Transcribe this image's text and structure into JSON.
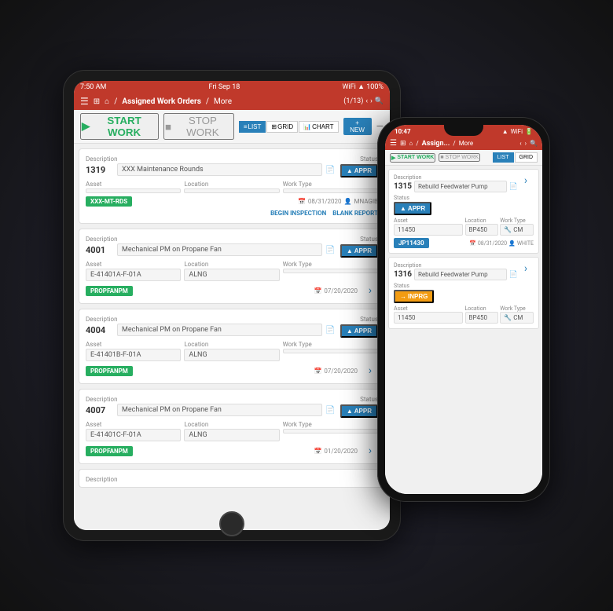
{
  "tablet": {
    "status_bar": {
      "time": "7:50 AM",
      "date": "Fri Sep 18",
      "wifi": "WiFi",
      "battery": "100%"
    },
    "toolbar": {
      "title": "Assigned Work Orders",
      "more": "More",
      "page_count": "(1/13)"
    },
    "action_bar": {
      "start_work": "START WORK",
      "stop_work": "STOP WORK",
      "view_list": "LIST",
      "view_grid": "GRID",
      "view_chart": "CHART",
      "new": "+ NEW"
    },
    "cards": [
      {
        "id": "1319",
        "desc_label": "Description",
        "description": "XXX Maintenance Rounds",
        "status_label": "Status",
        "status": "APPR",
        "asset_label": "Asset",
        "asset": "",
        "location_label": "Location",
        "location": "",
        "worktype_label": "Work Type",
        "worktype": "",
        "tag": "XXX-MT-RDS",
        "tag_color": "green",
        "date": "08/31/2020",
        "user": "MNAGIB",
        "actions": [
          "BEGIN INSPECTION",
          "BLANK REPORT"
        ]
      },
      {
        "id": "4001",
        "desc_label": "Description",
        "description": "Mechanical PM on Propane Fan",
        "status_label": "Status",
        "status": "APPR",
        "asset_label": "Asset",
        "asset": "E-41401A-F-01A",
        "location_label": "Location",
        "location": "ALNG",
        "worktype_label": "Work Type",
        "worktype": "",
        "tag": "PROPFANPM",
        "tag_color": "green",
        "date": "07/20/2020",
        "user": ""
      },
      {
        "id": "4004",
        "desc_label": "Description",
        "description": "Mechanical PM on Propane Fan",
        "status_label": "Status",
        "status": "APPR",
        "asset_label": "Asset",
        "asset": "E-41401B-F-01A",
        "location_label": "Location",
        "location": "ALNG",
        "worktype_label": "Work Type",
        "worktype": "",
        "tag": "PROPFANPM",
        "tag_color": "green",
        "date": "07/20/2020",
        "user": ""
      },
      {
        "id": "4007",
        "desc_label": "Description",
        "description": "Mechanical PM on Propane Fan",
        "status_label": "Status",
        "status": "APPR",
        "asset_label": "Asset",
        "asset": "E-41401C-F-01A",
        "location_label": "Location",
        "location": "ALNG",
        "worktype_label": "Work Type",
        "worktype": "",
        "tag": "PROPFANPM",
        "tag_color": "green",
        "date": "01/20/2020",
        "user": ""
      }
    ]
  },
  "phone": {
    "status_bar": {
      "time": "10:47",
      "signal": "●●●●",
      "wifi": "WiFi",
      "battery": "●"
    },
    "toolbar": {
      "title": "Assign...",
      "more": "More"
    },
    "action_bar": {
      "start_work": "START WORK",
      "stop_work": "STOP WORK",
      "view_list": "LIST",
      "view_grid": "GRID"
    },
    "cards": [
      {
        "id": "1315",
        "desc_label": "Description",
        "description": "Rebuild Feedwater Pump",
        "status_label": "Status",
        "status": "APPR",
        "status_type": "appr",
        "asset_label": "Asset",
        "asset": "11450",
        "location_label": "Location",
        "location": "BP450",
        "worktype_label": "Work Type",
        "worktype": "CM",
        "tag": "JP11430",
        "tag_color": "blue",
        "date": "08/31/2020",
        "user": "WHITE"
      },
      {
        "id": "1316",
        "desc_label": "Description",
        "description": "Rebuild Feedwater Pump",
        "status_label": "Status",
        "status": "INPRG",
        "status_type": "inprg",
        "asset_label": "Asset",
        "asset": "11450",
        "location_label": "Location",
        "location": "BP450",
        "worktype_label": "Work Type",
        "worktype": "CM"
      }
    ]
  },
  "icons": {
    "home": "⌂",
    "menu": "☰",
    "grid": "⊞",
    "search": "🔍",
    "chevron_left": "‹",
    "chevron_right": "›",
    "plus": "+",
    "triangle": "▲",
    "arrow_right": "→",
    "bar_chart": "📊",
    "list": "≡",
    "wrench": "🔧",
    "person": "👤",
    "calendar": "📅",
    "doc": "📄"
  }
}
